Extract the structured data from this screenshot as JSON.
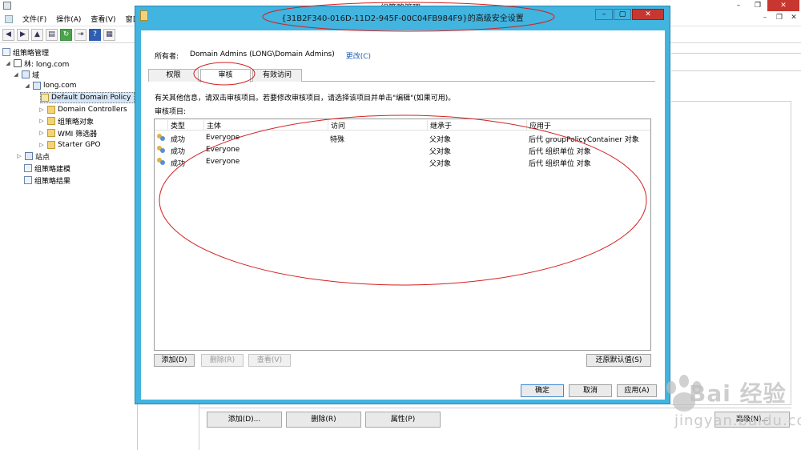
{
  "background_window": {
    "title": "组策略管理",
    "menu": [
      "文件(F)",
      "操作(A)",
      "查看(V)",
      "窗口(W)"
    ],
    "window_buttons": [
      "–",
      "❐",
      "✕"
    ],
    "menu_right_buttons": [
      "–",
      "❐",
      "✕"
    ]
  },
  "tree": {
    "root": "组策略管理",
    "forest": "林: long.com",
    "domains": "域",
    "domain": "long.com",
    "items": [
      "Default Domain Policy",
      "Domain Controllers",
      "组策略对象",
      "WMI 筛选器",
      "Starter GPO"
    ],
    "sites": "站点",
    "modeling": "组策略建模",
    "results": "组策略结果"
  },
  "right_pane_buttons": {
    "add": "添加(D)...",
    "remove": "删除(R)",
    "properties": "属性(P)",
    "advanced": "高级(N)..."
  },
  "dialog": {
    "title": "{31B2F340-016D-11D2-945F-00C04FB984F9}的高级安全设置",
    "owner_label": "所有者:",
    "owner_value": "Domain Admins (LONG\\Domain Admins)",
    "owner_change": "更改(C)",
    "tabs": [
      "权限",
      "审核",
      "有效访问"
    ],
    "active_tab": "审核",
    "info": "有关其他信息，请双击审核项目。若要修改审核项目，请选择该项目并单击\"编辑\"(如果可用)。",
    "entries_label": "审核项目:",
    "columns": [
      "类型",
      "主体",
      "访问",
      "继承于",
      "应用于"
    ],
    "rows": [
      {
        "type": "成功",
        "principal": "Everyone",
        "access": "特殊",
        "inherited": "父对象",
        "applies": "后代 groupPolicyContainer 对象"
      },
      {
        "type": "成功",
        "principal": "Everyone",
        "access": "",
        "inherited": "父对象",
        "applies": "后代 组织单位 对象"
      },
      {
        "type": "成功",
        "principal": "Everyone",
        "access": "",
        "inherited": "父对象",
        "applies": "后代 组织单位 对象"
      }
    ],
    "buttons": {
      "add": "添加(D)",
      "remove": "删除(R)",
      "view": "查看(V)",
      "restore": "还原默认值(S)",
      "ok": "确定",
      "cancel": "取消",
      "apply": "应用(A)"
    }
  },
  "watermark": {
    "text": "Bai 经验",
    "sub": "jingyan.baidu.com"
  },
  "colors": {
    "dialog_frame": "#41b4e0",
    "annotation": "#d42020",
    "close_button": "#c7372f",
    "link": "#1a5fb4"
  }
}
